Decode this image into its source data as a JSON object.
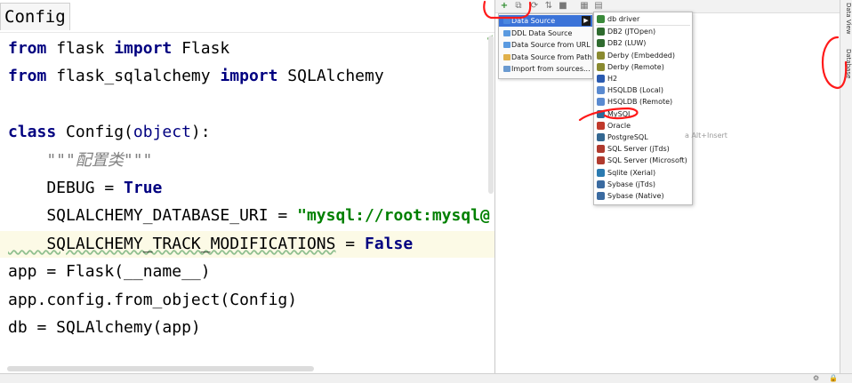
{
  "editor": {
    "tab_name": "Config",
    "lines": [
      [
        [
          "kw",
          "from"
        ],
        [
          "t",
          " flask "
        ],
        [
          "kw",
          "import"
        ],
        [
          "t",
          " Flask"
        ]
      ],
      [
        [
          "kw",
          "from"
        ],
        [
          "t",
          " flask_sqlalchemy "
        ],
        [
          "kw",
          "import"
        ],
        [
          "t",
          " SQLAlchemy"
        ]
      ],
      [],
      [
        [
          "kw",
          "class"
        ],
        [
          "t",
          " Config("
        ],
        [
          "obj",
          "object"
        ],
        [
          "t",
          "):"
        ]
      ],
      [
        [
          "doc",
          "    \"\"\"配置类\"\"\""
        ]
      ],
      [
        [
          "t",
          "    DEBUG = "
        ],
        [
          "kw",
          "True"
        ]
      ],
      [
        [
          "t",
          "    SQLALCHEMY_DATABASE_URI = "
        ],
        [
          "str",
          "\"mysql://root:mysql@"
        ]
      ],
      [
        [
          "wave",
          "    SQLALCHEMY_TRACK_MODIFICATIONS"
        ],
        [
          "t",
          " = "
        ],
        [
          "kw",
          "False"
        ]
      ],
      [
        [
          "t",
          "app = Flask(__name__)"
        ]
      ],
      [
        [
          "t",
          "app.config.from_object(Config)"
        ]
      ],
      [
        [
          "t",
          "db = SQLAlchemy(app)"
        ]
      ]
    ]
  },
  "db_panel": {
    "add_menu": {
      "items": [
        {
          "label": "Data Source",
          "icon": "datasource-icon",
          "selected": true,
          "has_submenu": true,
          "color": "#4b88e0"
        },
        {
          "label": "DDL Data Source",
          "icon": "ddl-icon",
          "selected": false,
          "has_submenu": false,
          "color": "#5a9ae0"
        },
        {
          "label": "Data Source from URL",
          "icon": "url-icon",
          "selected": false,
          "has_submenu": false,
          "color": "#5a9ae0"
        },
        {
          "label": "Data Source from Path",
          "icon": "folder-icon",
          "selected": false,
          "has_submenu": false,
          "color": "#e0b04a"
        },
        {
          "label": "Import from sources...",
          "icon": "import-icon",
          "selected": false,
          "has_submenu": false,
          "color": "#6a9ad0"
        }
      ]
    },
    "driver_menu": {
      "items": [
        {
          "label": "db driver",
          "icon": "driver-icon",
          "color": "#3a8a3a"
        },
        {
          "label": "DB2 (JTOpen)",
          "icon": "db2-icon",
          "color": "#2f6b2f"
        },
        {
          "label": "DB2 (LUW)",
          "icon": "db2-icon",
          "color": "#2f6b2f"
        },
        {
          "label": "Derby (Embedded)",
          "icon": "derby-icon",
          "color": "#8a8a30"
        },
        {
          "label": "Derby (Remote)",
          "icon": "derby-icon",
          "color": "#8a8a30"
        },
        {
          "label": "H2",
          "icon": "h2-icon",
          "color": "#2a5ab0"
        },
        {
          "label": "HSQLDB (Local)",
          "icon": "hsqldb-icon",
          "color": "#5a8ad0"
        },
        {
          "label": "HSQLDB (Remote)",
          "icon": "hsqldb-icon",
          "color": "#5a8ad0"
        },
        {
          "label": "MySQL",
          "icon": "mysql-icon",
          "color": "#2a6a9a"
        },
        {
          "label": "Oracle",
          "icon": "oracle-icon",
          "color": "#c0392b"
        },
        {
          "label": "PostgreSQL",
          "icon": "postgresql-icon",
          "color": "#336791"
        },
        {
          "label": "SQL Server (jTds)",
          "icon": "sqlserver-icon",
          "color": "#b03a2e"
        },
        {
          "label": "SQL Server (Microsoft)",
          "icon": "sqlserver-icon",
          "color": "#b03a2e"
        },
        {
          "label": "Sqlite (Xerial)",
          "icon": "sqlite-icon",
          "color": "#2a7ab0"
        },
        {
          "label": "Sybase (jTds)",
          "icon": "sybase-icon",
          "color": "#3a6aa0"
        },
        {
          "label": "Sybase (Native)",
          "icon": "sybase-icon",
          "color": "#3a6aa0"
        }
      ]
    },
    "hint": "a Alt+Insert"
  },
  "tool_strip": {
    "tabs": [
      "Data View",
      "Database"
    ]
  },
  "colors": {
    "keyword": "#000080",
    "string": "#008000",
    "selection": "#3b73d8",
    "annotation": "#ff1a1a"
  }
}
